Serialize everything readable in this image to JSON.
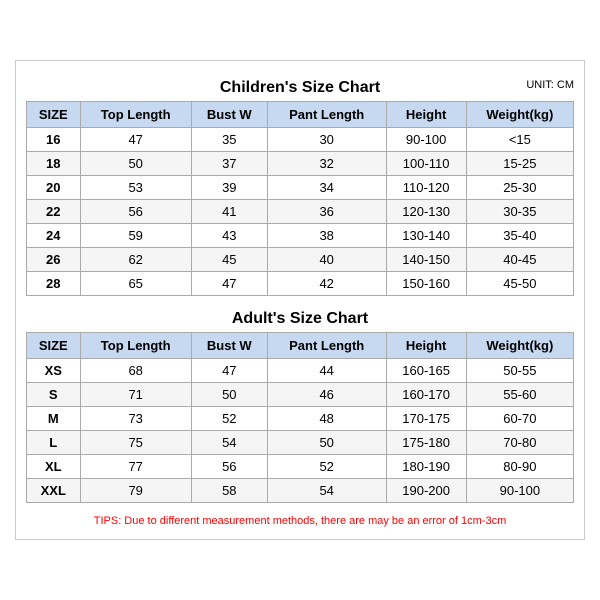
{
  "children_title": "Children's Size Chart",
  "adult_title": "Adult's Size Chart",
  "unit": "UNIT: CM",
  "columns": [
    "SIZE",
    "Top Length",
    "Bust W",
    "Pant Length",
    "Height",
    "Weight(kg)"
  ],
  "children_rows": [
    [
      "16",
      "47",
      "35",
      "30",
      "90-100",
      "<15"
    ],
    [
      "18",
      "50",
      "37",
      "32",
      "100-110",
      "15-25"
    ],
    [
      "20",
      "53",
      "39",
      "34",
      "110-120",
      "25-30"
    ],
    [
      "22",
      "56",
      "41",
      "36",
      "120-130",
      "30-35"
    ],
    [
      "24",
      "59",
      "43",
      "38",
      "130-140",
      "35-40"
    ],
    [
      "26",
      "62",
      "45",
      "40",
      "140-150",
      "40-45"
    ],
    [
      "28",
      "65",
      "47",
      "42",
      "150-160",
      "45-50"
    ]
  ],
  "adult_rows": [
    [
      "XS",
      "68",
      "47",
      "44",
      "160-165",
      "50-55"
    ],
    [
      "S",
      "71",
      "50",
      "46",
      "160-170",
      "55-60"
    ],
    [
      "M",
      "73",
      "52",
      "48",
      "170-175",
      "60-70"
    ],
    [
      "L",
      "75",
      "54",
      "50",
      "175-180",
      "70-80"
    ],
    [
      "XL",
      "77",
      "56",
      "52",
      "180-190",
      "80-90"
    ],
    [
      "XXL",
      "79",
      "58",
      "54",
      "190-200",
      "90-100"
    ]
  ],
  "tips": "TIPS: Due to different measurement methods, there are may be an error of 1cm-3cm"
}
